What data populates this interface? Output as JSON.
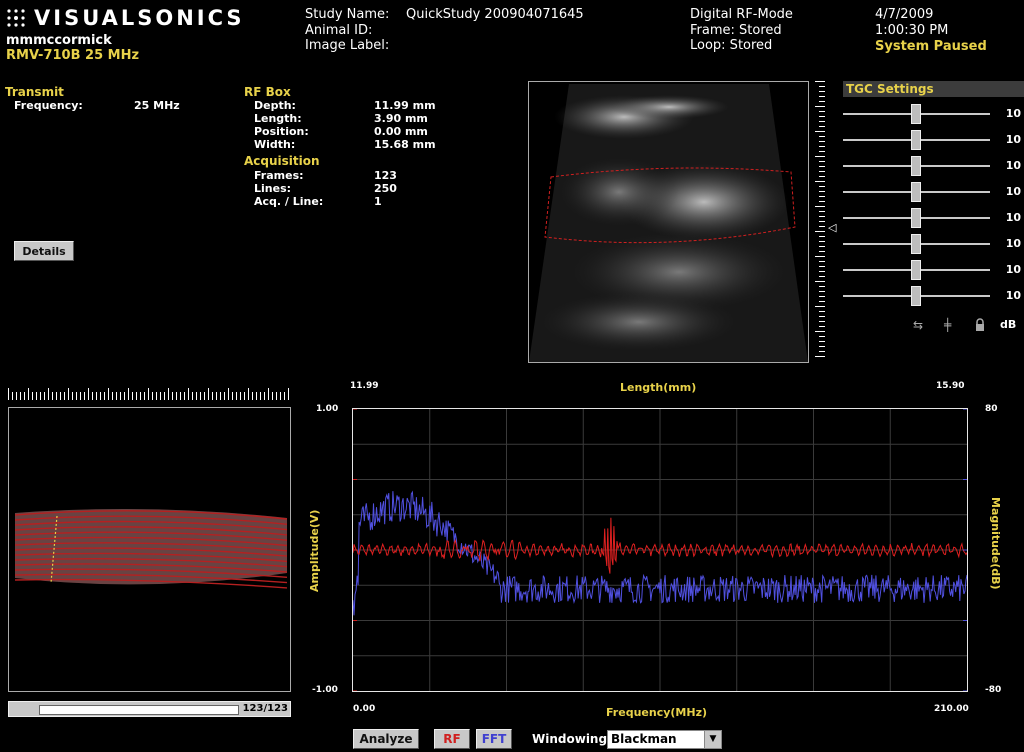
{
  "brand": {
    "name": "VISUALSONICS"
  },
  "user": {
    "name": "mmmccormick",
    "probe": "RMV-710B  25 MHz"
  },
  "study": {
    "name_label": "Study Name:",
    "name_value": "QuickStudy 200904071645",
    "animal_label": "Animal ID:",
    "image_label": "Image Label:"
  },
  "mode": {
    "title": "Digital RF-Mode",
    "frame": "Frame: Stored",
    "loop": "Loop: Stored"
  },
  "datetime": {
    "date": "4/7/2009",
    "time": "1:00:30 PM",
    "status": "System Paused"
  },
  "transmit": {
    "title": "Transmit",
    "freq_label": "Frequency:",
    "freq_value": "25 MHz"
  },
  "rfbox": {
    "title": "RF Box",
    "rows": [
      {
        "label": "Depth:",
        "value": "11.99 mm"
      },
      {
        "label": "Length:",
        "value": "3.90 mm"
      },
      {
        "label": "Position:",
        "value": "0.00 mm"
      },
      {
        "label": "Width:",
        "value": "15.68 mm"
      }
    ]
  },
  "acquisition": {
    "title": "Acquisition",
    "rows": [
      {
        "label": "Frames:",
        "value": "123"
      },
      {
        "label": "Lines:",
        "value": "250"
      },
      {
        "label": "Acq. / Line:",
        "value": "1"
      }
    ]
  },
  "details_button": "Details",
  "tgc": {
    "title": "TGC Settings",
    "values": [
      "10",
      "10",
      "10",
      "10",
      "10",
      "10",
      "10",
      "10"
    ],
    "unit": "dB"
  },
  "frame_counter": {
    "label": "123/123",
    "progress": 1.0
  },
  "chart_data": {
    "type": "line",
    "title": "",
    "top_label": "Length(mm)",
    "top_range_labels": [
      "11.99",
      "15.90"
    ],
    "xlabel": "Frequency(MHz)",
    "x_range_labels": [
      "0.00",
      "210.00"
    ],
    "ylabel_left": "Amplitude(V)",
    "ylabel_right": "Magnitude(dB)",
    "y_left_ticks": [
      "1.00",
      "-1.00"
    ],
    "y_right_ticks": [
      "80",
      "-80"
    ],
    "xlim": [
      0,
      210
    ],
    "ylim_left": [
      -1,
      1
    ],
    "ylim_right": [
      -80,
      80
    ],
    "grid": true,
    "series": [
      {
        "name": "RF",
        "color": "#e02020"
      },
      {
        "name": "FFT",
        "color": "#5050e0"
      }
    ]
  },
  "controls": {
    "analyze": "Analyze",
    "rf": "RF",
    "fft": "FFT",
    "windowing_label": "Windowing",
    "windowing_value": "Blackman"
  },
  "colors": {
    "accent": "#e8d24a",
    "rf": "#e02020",
    "fft": "#5050e0"
  }
}
